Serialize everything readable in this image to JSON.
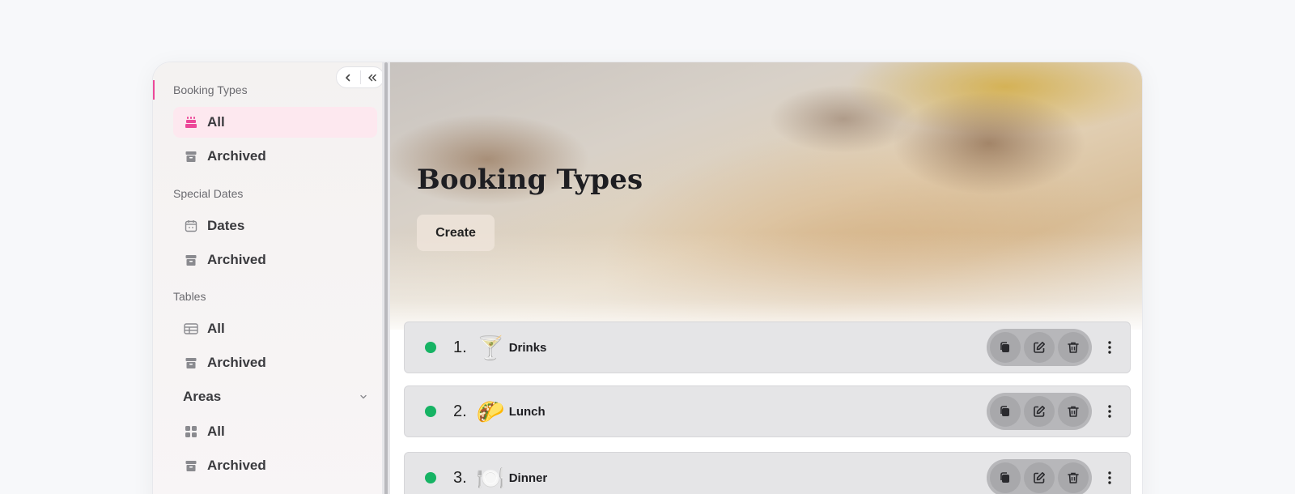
{
  "sidebar": {
    "sections": [
      {
        "title": "Booking Types"
      },
      {
        "title": "Special Dates"
      },
      {
        "title": "Tables"
      }
    ],
    "items": [
      {
        "label": "All",
        "icon": "cake-icon",
        "active": true
      },
      {
        "label": "Archived",
        "icon": "archive-icon"
      },
      {
        "label": "Dates",
        "icon": "calendar-icon"
      },
      {
        "label": "Archived",
        "icon": "archive-icon"
      },
      {
        "label": "All",
        "icon": "table-icon"
      },
      {
        "label": "Archived",
        "icon": "archive-icon"
      },
      {
        "label": "All",
        "icon": "grid-icon"
      },
      {
        "label": "Archived",
        "icon": "archive-icon"
      }
    ],
    "areas_group": {
      "label": "Areas",
      "icon": "chevron-down-icon"
    },
    "controls": {
      "collapse": "chevron-left-icon",
      "collapse_all": "double-chevron-left-icon"
    }
  },
  "main": {
    "title": "Booking Types",
    "create_label": "Create",
    "rows": [
      {
        "number": "1.",
        "emoji": "🍸",
        "name": "Drinks",
        "status_color": "#16b364"
      },
      {
        "number": "2.",
        "emoji": "🌮",
        "name": "Lunch",
        "status_color": "#16b364"
      },
      {
        "number": "3.",
        "emoji": "🍽️",
        "name": "Dinner",
        "status_color": "#16b364"
      }
    ],
    "row_actions": [
      "duplicate-icon",
      "edit-icon",
      "trash-icon",
      "more-vertical-icon"
    ]
  },
  "colors": {
    "accent": "#ec4899",
    "active_bg": "#fde8ef",
    "status_active": "#16b364"
  }
}
